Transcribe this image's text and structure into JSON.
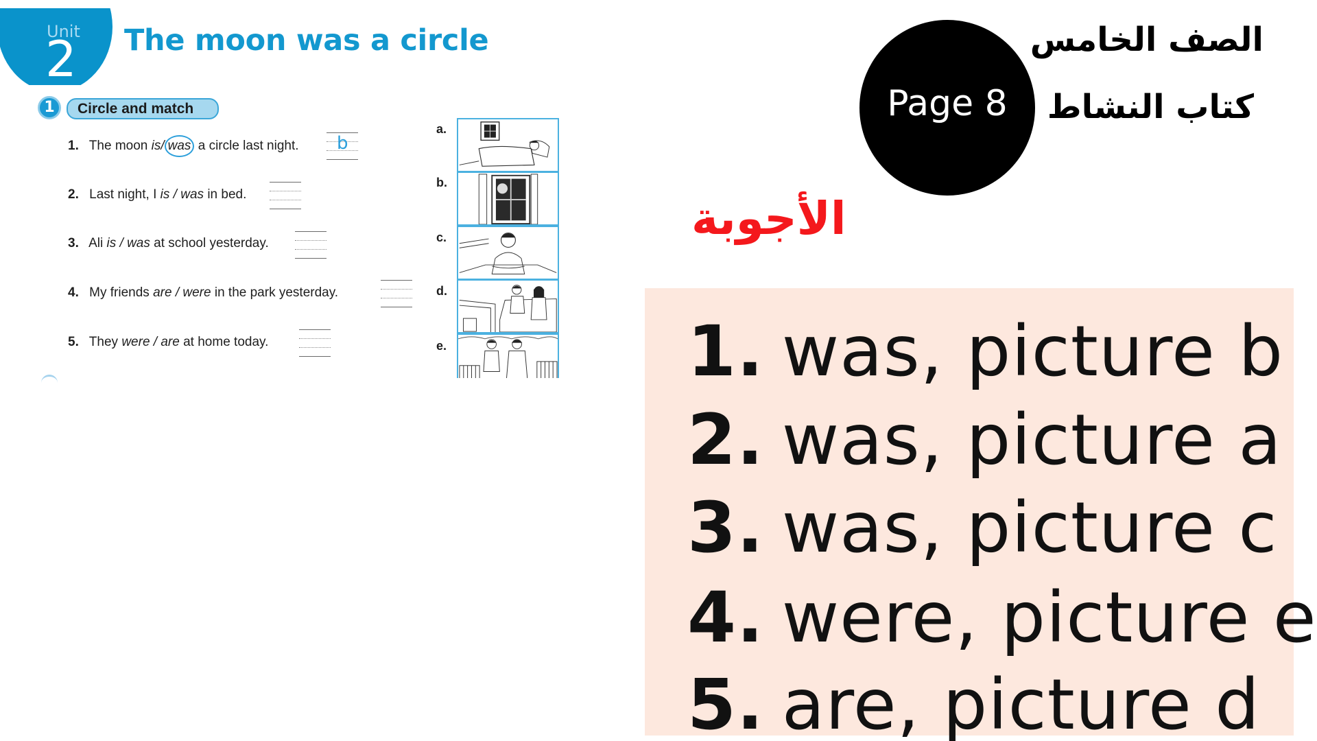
{
  "worksheet": {
    "unit_label": "Unit",
    "unit_number": "2",
    "title": "The moon was a circle",
    "exercise_number": "1",
    "exercise_instruction": "Circle and match",
    "questions": [
      {
        "num": "1.",
        "before": "The moon",
        "opt1": "is",
        "sep": "/",
        "opt2": "was",
        "circled": "was",
        "after": "a circle last night.",
        "answer": "b"
      },
      {
        "num": "2.",
        "before": "Last night, I",
        "opt1": "is",
        "sep": "/",
        "opt2": "was",
        "circled": "",
        "after": "in bed.",
        "answer": ""
      },
      {
        "num": "3.",
        "before": "Ali",
        "opt1": "is",
        "sep": "/",
        "opt2": "was",
        "circled": "",
        "after": "at school yesterday.",
        "answer": ""
      },
      {
        "num": "4.",
        "before": "My friends",
        "opt1": "are",
        "sep": "/",
        "opt2": "were",
        "circled": "",
        "after": "in the park yesterday.",
        "answer": ""
      },
      {
        "num": "5.",
        "before": "They",
        "opt1": "were",
        "sep": "/",
        "opt2": "are",
        "circled": "",
        "after": "at home today.",
        "answer": ""
      }
    ],
    "pictures": [
      {
        "label": "a.",
        "description": "boy sleeping in bed"
      },
      {
        "label": "b.",
        "description": "full moon through window"
      },
      {
        "label": "c.",
        "description": "boy sitting at a desk"
      },
      {
        "label": "d.",
        "description": "two children sitting on a sofa"
      },
      {
        "label": "e.",
        "description": "two children standing in a park"
      }
    ]
  },
  "header": {
    "page_badge": "Page 8",
    "grade": "الصف الخامس",
    "book": "كتاب النشاط",
    "answers_heading": "الأجوبة"
  },
  "answers": [
    {
      "num": "1.",
      "text": "was, picture b"
    },
    {
      "num": "2.",
      "text": "was, picture a"
    },
    {
      "num": "3.",
      "text": "was, picture c"
    },
    {
      "num": "4.",
      "text": "were, picture e"
    },
    {
      "num": "5.",
      "text": "are, picture d"
    }
  ],
  "colors": {
    "unit_blue": "#0a93cb",
    "title_blue": "#1398cf",
    "pill_fill": "#a6d8ef",
    "answer_ink": "#2c9fdb",
    "answers_heading_red": "#f4181c",
    "answers_box_bg": "#fde8de"
  }
}
